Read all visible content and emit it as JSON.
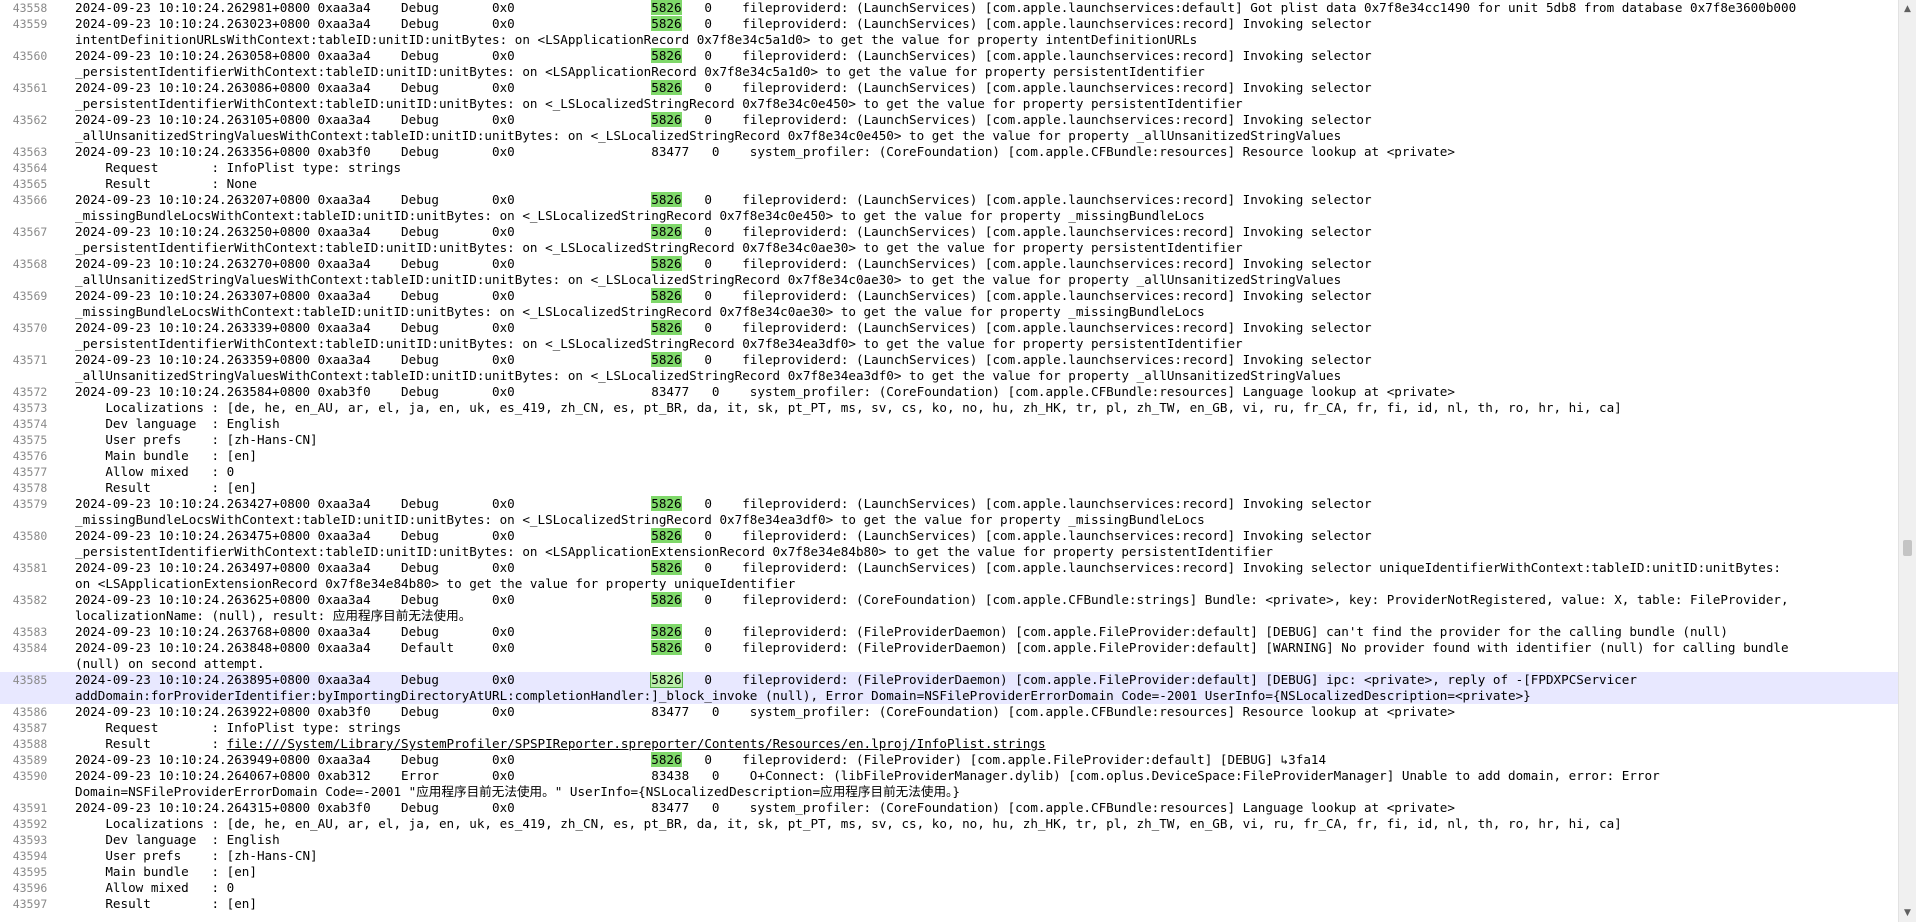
{
  "pid_highlight": "5826",
  "lines": [
    {
      "n": "43558",
      "parts": [
        {
          "t": "2024-09-23 10:10:24.262981+0800 0xaa3a4    Debug       0x0                  "
        },
        {
          "t": "5826",
          "c": "pid"
        },
        {
          "t": "   0    fileproviderd: (LaunchServices) [com.apple.launchservices:default] Got plist data 0x7f8e34cc1490 for unit 5db8 from database 0x7f8e3600b000"
        }
      ]
    },
    {
      "n": "43559",
      "parts": [
        {
          "t": "2024-09-23 10:10:24.263023+0800 0xaa3a4    Debug       0x0                  "
        },
        {
          "t": "5826",
          "c": "pid"
        },
        {
          "t": "   0    fileproviderd: (LaunchServices) [com.apple.launchservices:record] Invoking selector"
        }
      ]
    },
    {
      "n": "",
      "parts": [
        {
          "t": "intentDefinitionURLsWithContext:tableID:unitID:unitBytes: on <LSApplicationRecord 0x7f8e34c5a1d0> to get the value for property intentDefinitionURLs"
        }
      ]
    },
    {
      "n": "43560",
      "parts": [
        {
          "t": "2024-09-23 10:10:24.263058+0800 0xaa3a4    Debug       0x0                  "
        },
        {
          "t": "5826",
          "c": "pid"
        },
        {
          "t": "   0    fileproviderd: (LaunchServices) [com.apple.launchservices:record] Invoking selector"
        }
      ]
    },
    {
      "n": "",
      "parts": [
        {
          "t": "_persistentIdentifierWithContext:tableID:unitID:unitBytes: on <LSApplicationRecord 0x7f8e34c5a1d0> to get the value for property persistentIdentifier"
        }
      ]
    },
    {
      "n": "43561",
      "parts": [
        {
          "t": "2024-09-23 10:10:24.263086+0800 0xaa3a4    Debug       0x0                  "
        },
        {
          "t": "5826",
          "c": "pid"
        },
        {
          "t": "   0    fileproviderd: (LaunchServices) [com.apple.launchservices:record] Invoking selector"
        }
      ]
    },
    {
      "n": "",
      "parts": [
        {
          "t": "_persistentIdentifierWithContext:tableID:unitID:unitBytes: on <_LSLocalizedStringRecord 0x7f8e34c0e450> to get the value for property persistentIdentifier"
        }
      ]
    },
    {
      "n": "43562",
      "parts": [
        {
          "t": "2024-09-23 10:10:24.263105+0800 0xaa3a4    Debug       0x0                  "
        },
        {
          "t": "5826",
          "c": "pid"
        },
        {
          "t": "   0    fileproviderd: (LaunchServices) [com.apple.launchservices:record] Invoking selector"
        }
      ]
    },
    {
      "n": "",
      "parts": [
        {
          "t": "_allUnsanitizedStringValuesWithContext:tableID:unitID:unitBytes: on <_LSLocalizedStringRecord 0x7f8e34c0e450> to get the value for property _allUnsanitizedStringValues"
        }
      ]
    },
    {
      "n": "43563",
      "parts": [
        {
          "t": "2024-09-23 10:10:24.263356+0800 0xab3f0    Debug       0x0                  83477   0    system_profiler: (CoreFoundation) [com.apple.CFBundle:resources] Resource lookup at <private>"
        }
      ]
    },
    {
      "n": "43564",
      "parts": [
        {
          "t": "    Request       : InfoPlist type: strings"
        }
      ]
    },
    {
      "n": "43565",
      "parts": [
        {
          "t": "    Result        : None"
        }
      ]
    },
    {
      "n": "43566",
      "parts": [
        {
          "t": "2024-09-23 10:10:24.263207+0800 0xaa3a4    Debug       0x0                  "
        },
        {
          "t": "5826",
          "c": "pid"
        },
        {
          "t": "   0    fileproviderd: (LaunchServices) [com.apple.launchservices:record] Invoking selector"
        }
      ]
    },
    {
      "n": "",
      "parts": [
        {
          "t": "_missingBundleLocsWithContext:tableID:unitID:unitBytes: on <_LSLocalizedStringRecord 0x7f8e34c0e450> to get the value for property _missingBundleLocs"
        }
      ]
    },
    {
      "n": "43567",
      "parts": [
        {
          "t": "2024-09-23 10:10:24.263250+0800 0xaa3a4    Debug       0x0                  "
        },
        {
          "t": "5826",
          "c": "pid"
        },
        {
          "t": "   0    fileproviderd: (LaunchServices) [com.apple.launchservices:record] Invoking selector"
        }
      ]
    },
    {
      "n": "",
      "parts": [
        {
          "t": "_persistentIdentifierWithContext:tableID:unitID:unitBytes: on <_LSLocalizedStringRecord 0x7f8e34c0ae30> to get the value for property persistentIdentifier"
        }
      ]
    },
    {
      "n": "43568",
      "parts": [
        {
          "t": "2024-09-23 10:10:24.263270+0800 0xaa3a4    Debug       0x0                  "
        },
        {
          "t": "5826",
          "c": "pid"
        },
        {
          "t": "   0    fileproviderd: (LaunchServices) [com.apple.launchservices:record] Invoking selector"
        }
      ]
    },
    {
      "n": "",
      "parts": [
        {
          "t": "_allUnsanitizedStringValuesWithContext:tableID:unitID:unitBytes: on <_LSLocalizedStringRecord 0x7f8e34c0ae30> to get the value for property _allUnsanitizedStringValues"
        }
      ]
    },
    {
      "n": "43569",
      "parts": [
        {
          "t": "2024-09-23 10:10:24.263307+0800 0xaa3a4    Debug       0x0                  "
        },
        {
          "t": "5826",
          "c": "pid"
        },
        {
          "t": "   0    fileproviderd: (LaunchServices) [com.apple.launchservices:record] Invoking selector"
        }
      ]
    },
    {
      "n": "",
      "parts": [
        {
          "t": "_missingBundleLocsWithContext:tableID:unitID:unitBytes: on <_LSLocalizedStringRecord 0x7f8e34c0ae30> to get the value for property _missingBundleLocs"
        }
      ]
    },
    {
      "n": "43570",
      "parts": [
        {
          "t": "2024-09-23 10:10:24.263339+0800 0xaa3a4    Debug       0x0                  "
        },
        {
          "t": "5826",
          "c": "pid"
        },
        {
          "t": "   0    fileproviderd: (LaunchServices) [com.apple.launchservices:record] Invoking selector"
        }
      ]
    },
    {
      "n": "",
      "parts": [
        {
          "t": "_persistentIdentifierWithContext:tableID:unitID:unitBytes: on <_LSLocalizedStringRecord 0x7f8e34ea3df0> to get the value for property persistentIdentifier"
        }
      ]
    },
    {
      "n": "43571",
      "parts": [
        {
          "t": "2024-09-23 10:10:24.263359+0800 0xaa3a4    Debug       0x0                  "
        },
        {
          "t": "5826",
          "c": "pid"
        },
        {
          "t": "   0    fileproviderd: (LaunchServices) [com.apple.launchservices:record] Invoking selector"
        }
      ]
    },
    {
      "n": "",
      "parts": [
        {
          "t": "_allUnsanitizedStringValuesWithContext:tableID:unitID:unitBytes: on <_LSLocalizedStringRecord 0x7f8e34ea3df0> to get the value for property _allUnsanitizedStringValues"
        }
      ]
    },
    {
      "n": "43572",
      "parts": [
        {
          "t": "2024-09-23 10:10:24.263584+0800 0xab3f0    Debug       0x0                  83477   0    system_profiler: (CoreFoundation) [com.apple.CFBundle:resources] Language lookup at <private>"
        }
      ]
    },
    {
      "n": "43573",
      "parts": [
        {
          "t": "    Localizations : [de, he, en_AU, ar, el, ja, en, uk, es_419, zh_CN, es, pt_BR, da, it, sk, pt_PT, ms, sv, cs, ko, no, hu, zh_HK, tr, pl, zh_TW, en_GB, vi, ru, fr_CA, fr, fi, id, nl, th, ro, hr, hi, ca]"
        }
      ]
    },
    {
      "n": "43574",
      "parts": [
        {
          "t": "    Dev language  : English"
        }
      ]
    },
    {
      "n": "43575",
      "parts": [
        {
          "t": "    User prefs    : [zh-Hans-CN]"
        }
      ]
    },
    {
      "n": "43576",
      "parts": [
        {
          "t": "    Main bundle   : [en]"
        }
      ]
    },
    {
      "n": "43577",
      "parts": [
        {
          "t": "    Allow mixed   : 0"
        }
      ]
    },
    {
      "n": "43578",
      "parts": [
        {
          "t": "    Result        : [en]"
        }
      ]
    },
    {
      "n": "43579",
      "parts": [
        {
          "t": "2024-09-23 10:10:24.263427+0800 0xaa3a4    Debug       0x0                  "
        },
        {
          "t": "5826",
          "c": "pid"
        },
        {
          "t": "   0    fileproviderd: (LaunchServices) [com.apple.launchservices:record] Invoking selector"
        }
      ]
    },
    {
      "n": "",
      "parts": [
        {
          "t": "_missingBundleLocsWithContext:tableID:unitID:unitBytes: on <_LSLocalizedStringRecord 0x7f8e34ea3df0> to get the value for property _missingBundleLocs"
        }
      ]
    },
    {
      "n": "43580",
      "parts": [
        {
          "t": "2024-09-23 10:10:24.263475+0800 0xaa3a4    Debug       0x0                  "
        },
        {
          "t": "5826",
          "c": "pid"
        },
        {
          "t": "   0    fileproviderd: (LaunchServices) [com.apple.launchservices:record] Invoking selector"
        }
      ]
    },
    {
      "n": "",
      "parts": [
        {
          "t": "_persistentIdentifierWithContext:tableID:unitID:unitBytes: on <LSApplicationExtensionRecord 0x7f8e34e84b80> to get the value for property persistentIdentifier"
        }
      ]
    },
    {
      "n": "43581",
      "parts": [
        {
          "t": "2024-09-23 10:10:24.263497+0800 0xaa3a4    Debug       0x0                  "
        },
        {
          "t": "5826",
          "c": "pid"
        },
        {
          "t": "   0    fileproviderd: (LaunchServices) [com.apple.launchservices:record] Invoking selector uniqueIdentifierWithContext:tableID:unitID:unitBytes:"
        }
      ]
    },
    {
      "n": "",
      "parts": [
        {
          "t": "on <LSApplicationExtensionRecord 0x7f8e34e84b80> to get the value for property uniqueIdentifier"
        }
      ]
    },
    {
      "n": "43582",
      "parts": [
        {
          "t": "2024-09-23 10:10:24.263625+0800 0xaa3a4    Debug       0x0                  "
        },
        {
          "t": "5826",
          "c": "pid"
        },
        {
          "t": "   0    fileproviderd: (CoreFoundation) [com.apple.CFBundle:strings] Bundle: <private>, key: ProviderNotRegistered, value: X, table: FileProvider,"
        }
      ]
    },
    {
      "n": "",
      "parts": [
        {
          "t": "localizationName: (null), result: 应用程序目前无法使用。"
        }
      ]
    },
    {
      "n": "43583",
      "parts": [
        {
          "t": "2024-09-23 10:10:24.263768+0800 0xaa3a4    Debug       0x0                  "
        },
        {
          "t": "5826",
          "c": "pid"
        },
        {
          "t": "   0    fileproviderd: (FileProviderDaemon) [com.apple.FileProvider:default] [DEBUG] can't find the provider for the calling bundle (null)"
        }
      ]
    },
    {
      "n": "43584",
      "parts": [
        {
          "t": "2024-09-23 10:10:24.263848+0800 0xaa3a4    Default     0x0                  "
        },
        {
          "t": "5826",
          "c": "pid"
        },
        {
          "t": "   0    fileproviderd: (FileProviderDaemon) [com.apple.FileProvider:default] [WARNING] No provider found with identifier (null) for calling bundle"
        }
      ]
    },
    {
      "n": "",
      "parts": [
        {
          "t": "(null) on second attempt."
        }
      ]
    },
    {
      "n": "43585",
      "hl": true,
      "parts": [
        {
          "t": "2024-09-23 10:10:24.263895+0800 0xaa3a4    Debug       0x0                  "
        },
        {
          "t": "5826",
          "c": "pid sel"
        },
        {
          "t": "   0    fileproviderd: (FileProviderDaemon) [com.apple.FileProvider:default] [DEBUG] ipc: <private>, reply of -[FPDXPCServicer"
        }
      ]
    },
    {
      "n": "",
      "hl": true,
      "parts": [
        {
          "t": "addDomain:forProviderIdentifier:byImportingDirectoryAtURL:completionHandler:]_block_invoke (null), Error Domain=NSFileProviderErrorDomain Code=-2001 UserInfo={NSLocalizedDescription=<private>}"
        }
      ]
    },
    {
      "n": "43586",
      "parts": [
        {
          "t": "2024-09-23 10:10:24.263922+0800 0xab3f0    Debug       0x0                  83477   0    system_profiler: (CoreFoundation) [com.apple.CFBundle:resources] Resource lookup at <private>"
        }
      ]
    },
    {
      "n": "43587",
      "parts": [
        {
          "t": "    Request       : InfoPlist type: strings"
        }
      ]
    },
    {
      "n": "43588",
      "parts": [
        {
          "t": "    Result        : "
        },
        {
          "t": "file:///System/Library/SystemProfiler/SPSPIReporter.spreporter/Contents/Resources/en.lproj/InfoPlist.strings",
          "c": "link"
        }
      ]
    },
    {
      "n": "43589",
      "parts": [
        {
          "t": "2024-09-23 10:10:24.263949+0800 0xaa3a4    Debug       0x0                  "
        },
        {
          "t": "5826",
          "c": "pid"
        },
        {
          "t": "   0    fileproviderd: (FileProvider) [com.apple.FileProvider:default] [DEBUG] ↳3fa14"
        }
      ]
    },
    {
      "n": "43590",
      "parts": [
        {
          "t": "2024-09-23 10:10:24.264067+0800 0xab312    Error       0x0                  83438   0    O+Connect: (libFileProviderManager.dylib) [com.oplus.DeviceSpace:FileProviderManager] Unable to add domain, error: Error"
        }
      ]
    },
    {
      "n": "",
      "parts": [
        {
          "t": "Domain=NSFileProviderErrorDomain Code=-2001 \"应用程序目前无法使用。\" UserInfo={NSLocalizedDescription=应用程序目前无法使用。}"
        }
      ]
    },
    {
      "n": "43591",
      "parts": [
        {
          "t": "2024-09-23 10:10:24.264315+0800 0xab3f0    Debug       0x0                  83477   0    system_profiler: (CoreFoundation) [com.apple.CFBundle:resources] Language lookup at <private>"
        }
      ]
    },
    {
      "n": "43592",
      "parts": [
        {
          "t": "    Localizations : [de, he, en_AU, ar, el, ja, en, uk, es_419, zh_CN, es, pt_BR, da, it, sk, pt_PT, ms, sv, cs, ko, no, hu, zh_HK, tr, pl, zh_TW, en_GB, vi, ru, fr_CA, fr, fi, id, nl, th, ro, hr, hi, ca]"
        }
      ]
    },
    {
      "n": "43593",
      "parts": [
        {
          "t": "    Dev language  : English"
        }
      ]
    },
    {
      "n": "43594",
      "parts": [
        {
          "t": "    User prefs    : [zh-Hans-CN]"
        }
      ]
    },
    {
      "n": "43595",
      "parts": [
        {
          "t": "    Main bundle   : [en]"
        }
      ]
    },
    {
      "n": "43596",
      "parts": [
        {
          "t": "    Allow mixed   : 0"
        }
      ]
    },
    {
      "n": "43597",
      "parts": [
        {
          "t": "    Result        : [en]"
        }
      ]
    }
  ],
  "scrollbar": {
    "up_icon": "▲",
    "down_icon": "▼",
    "position": 0.6
  },
  "colors": {
    "pid_highlight": "#7fd86a",
    "current_line": "#e8e8ff",
    "line_number": "#8a8a8a",
    "background": "#ffffff"
  }
}
